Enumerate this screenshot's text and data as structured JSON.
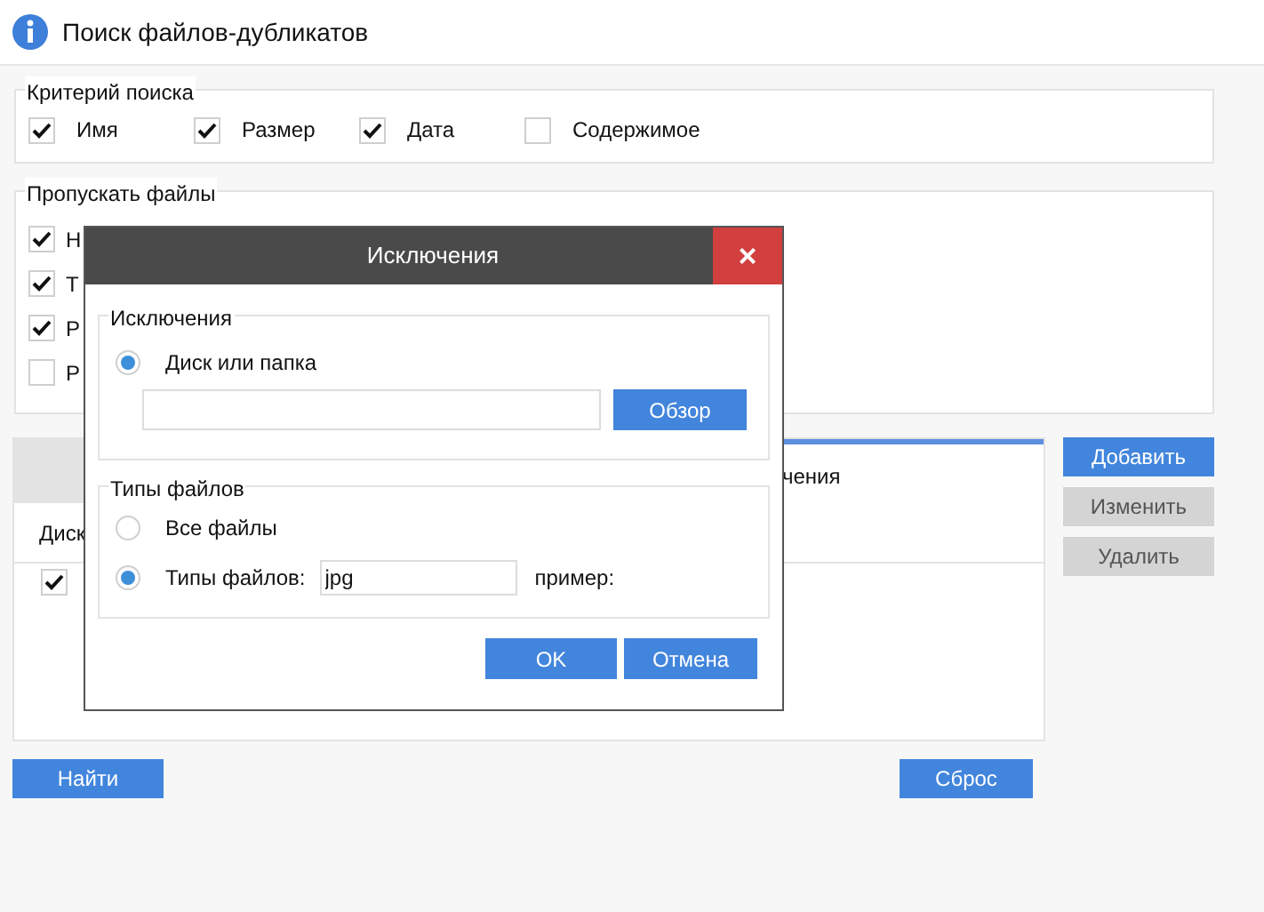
{
  "window": {
    "title": "Поиск файлов-дубликатов"
  },
  "criteria": {
    "title": "Критерий поиска",
    "items": [
      {
        "label": "Имя",
        "checked": true
      },
      {
        "label": "Размер",
        "checked": true
      },
      {
        "label": "Дата",
        "checked": true
      },
      {
        "label": "Содержимое",
        "checked": false
      }
    ]
  },
  "skip": {
    "title": "Пропускать файлы",
    "items": [
      {
        "label": "Н",
        "checked": true
      },
      {
        "label": "Т",
        "checked": true
      },
      {
        "label": "Р",
        "checked": true
      },
      {
        "label": "Р",
        "checked": false
      }
    ]
  },
  "tabs": [
    {
      "label": "чения",
      "selected": true
    }
  ],
  "table": {
    "columns": [
      "Диск"
    ],
    "rows": [
      {
        "checked": true
      }
    ]
  },
  "side_buttons": [
    {
      "label": "Добавить",
      "disabled": false
    },
    {
      "label": "Изменить",
      "disabled": true
    },
    {
      "label": "Удалить",
      "disabled": true
    }
  ],
  "find_button": "Найти",
  "reset_button": "Сброс",
  "dialog": {
    "title": "Исключения",
    "close": "×",
    "exclusions": {
      "title": "Исключения",
      "option": {
        "label": "Диск или папка",
        "selected": true
      },
      "browse": "Обзор"
    },
    "file_types": {
      "title": "Типы файлов",
      "options": [
        {
          "label": "Все файлы",
          "selected": false
        },
        {
          "label": "Типы файлов:",
          "selected": true
        }
      ],
      "value": "jpg",
      "example": "пример:"
    },
    "ok": "OK",
    "cancel": "Отмена"
  }
}
